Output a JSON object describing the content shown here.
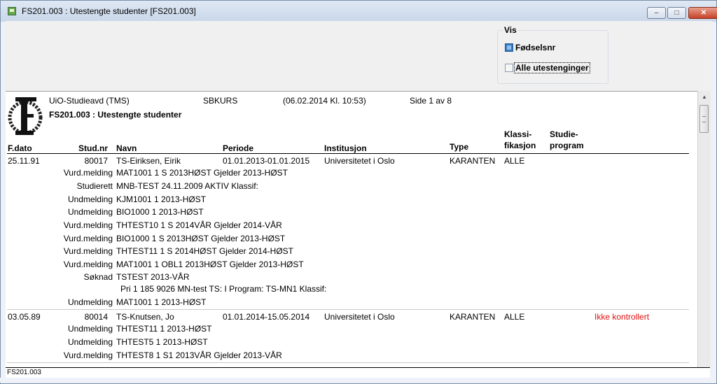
{
  "window": {
    "title": "FS201.003 : Utestengte studenter  [FS201.003]",
    "minimize": "–",
    "maximize": "□",
    "close": "✕"
  },
  "vis": {
    "legend": "Vis",
    "fodselsnr": {
      "label": "Fødselsnr",
      "checked": true
    },
    "alle": {
      "label": "Alle utestenginger",
      "checked": false
    }
  },
  "report_header": {
    "org": "UiO-Studieavd (TMS)",
    "user": "SBKURS",
    "timestamp": "(06.02.2014 Kl. 10:53)",
    "page": "Side 1 av 8",
    "title": "FS201.003 : Utestengte studenter"
  },
  "columns": {
    "fdato": "F.dato",
    "studnr": "Stud.nr",
    "navn": "Navn",
    "periode": "Periode",
    "institusjon": "Institusjon",
    "type": "Type",
    "klassi_1": "Klassi-",
    "klassi_2": "fikasjon",
    "studie_1": "Studie-",
    "studie_2": "program"
  },
  "records": [
    {
      "fdato": "25.11.91",
      "studnr": "80017",
      "navn": "TS-Eiriksen, Eirik",
      "periode": "01.01.2013-01.01.2015",
      "institusjon": "Universitetet i Oslo",
      "type": "KARANTEN",
      "klassifikasjon": "ALLE",
      "status": "",
      "details": [
        {
          "label": "Vurd.melding",
          "text": "MAT1001 1 S 2013HØST Gjelder 2013-HØST"
        },
        {
          "label": "Studierett",
          "text": "MNB-TEST 24.11.2009  AKTIV Klassif:"
        },
        {
          "label": "Undmelding",
          "text": "KJM1001 1 2013-HØST"
        },
        {
          "label": "Undmelding",
          "text": "BIO1000 1 2013-HØST"
        },
        {
          "label": "Vurd.melding",
          "text": "THTEST10 1 S 2014VÅR Gjelder 2014-VÅR"
        },
        {
          "label": "Vurd.melding",
          "text": "BIO1000 1 S 2013HØST Gjelder 2013-HØST"
        },
        {
          "label": "Vurd.melding",
          "text": "THTEST11 1 S 2014HØST Gjelder 2014-HØST"
        },
        {
          "label": "Vurd.melding",
          "text": "MAT1001 1 OBL1 2013HØST Gjelder 2013-HØST"
        },
        {
          "label": "Søknad",
          "text": "TSTEST 2013-VÅR"
        },
        {
          "label": "",
          "text": "Pri 1 185 9026 MN-test TS: I Program: TS-MN1 Klassif:"
        },
        {
          "label": "Undmelding",
          "text": "MAT1001 1 2013-HØST"
        }
      ]
    },
    {
      "fdato": "03.05.89",
      "studnr": "80014",
      "navn": "TS-Knutsen, Jo",
      "periode": "01.01.2014-15.05.2014",
      "institusjon": "Universitetet i Oslo",
      "type": "KARANTEN",
      "klassifikasjon": "ALLE",
      "status": "Ikke kontrollert",
      "details": [
        {
          "label": "Undmelding",
          "text": "THTEST11 1 2013-HØST"
        },
        {
          "label": "Undmelding",
          "text": "THTEST5 1 2013-HØST"
        },
        {
          "label": "Vurd.melding",
          "text": "THTEST8 1 S1 2013VÅR Gjelder 2013-VÅR"
        }
      ]
    }
  ],
  "statusbar": {
    "text": "FS201.003"
  },
  "colors": {
    "status_red": "#e01010",
    "accent": "#3b7dc4"
  }
}
